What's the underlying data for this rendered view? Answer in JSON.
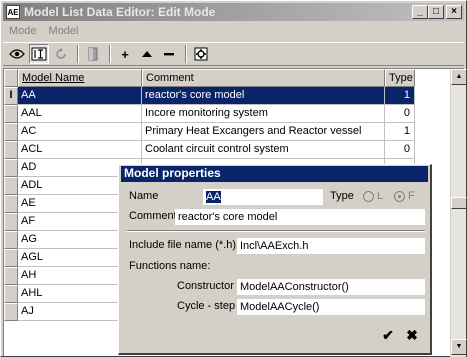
{
  "window": {
    "title": "Model List Data Editor: Edit Mode",
    "app_icon": "AE",
    "minimize": "_",
    "maximize": "□",
    "close": "×"
  },
  "menu": [
    {
      "label": "Mode"
    },
    {
      "label": "Model"
    }
  ],
  "toolbar": {
    "items": [
      "eye-icon",
      "text-edit-icon",
      "refresh-icon",
      "exit-door-icon",
      "add-icon",
      "move-up-icon",
      "remove-icon",
      "settings-icon"
    ],
    "labels": {
      "add": "+",
      "up": "▲",
      "remove": "−"
    }
  },
  "grid": {
    "columns": [
      "Model Name",
      "Comment",
      "Type"
    ],
    "selected_indicator": "I",
    "rows": [
      {
        "name": "AA",
        "comment": "reactor's core model",
        "type": "1"
      },
      {
        "name": "AAL",
        "comment": "Incore monitoring system",
        "type": "0"
      },
      {
        "name": "AC",
        "comment": "Primary Heat Excangers and Reactor vessel",
        "type": "1"
      },
      {
        "name": "ACL",
        "comment": "Coolant circuit control system",
        "type": "0"
      },
      {
        "name": "AD",
        "comment": "",
        "type": ""
      },
      {
        "name": "ADL",
        "comment": "",
        "type": ""
      },
      {
        "name": "AE",
        "comment": "",
        "type": ""
      },
      {
        "name": "AF",
        "comment": "",
        "type": ""
      },
      {
        "name": "AG",
        "comment": "",
        "type": ""
      },
      {
        "name": "AGL",
        "comment": "",
        "type": ""
      },
      {
        "name": "AH",
        "comment": "",
        "type": ""
      },
      {
        "name": "AHL",
        "comment": "",
        "type": ""
      },
      {
        "name": "AJ",
        "comment": "",
        "type": ""
      }
    ]
  },
  "dialog": {
    "title": "Model properties",
    "name_label": "Name",
    "name_value": "AA",
    "type_label": "Type",
    "type_options": [
      "L",
      "F"
    ],
    "comment_label": "Comment",
    "comment_value": "reactor's core model",
    "include_label": "Include file name (*.h)",
    "include_value": "Incl\\AAExch.h",
    "functions_label": "Functions name:",
    "constructor_label": "Constructor",
    "constructor_value": "ModelAAConstructor()",
    "cycle_label": "Cycle - step",
    "cycle_value": "ModelAACycle()",
    "ok_glyph": "✔",
    "cancel_glyph": "✖"
  },
  "colors": {
    "selection": "#0a246a",
    "face": "#d4d0c8"
  }
}
